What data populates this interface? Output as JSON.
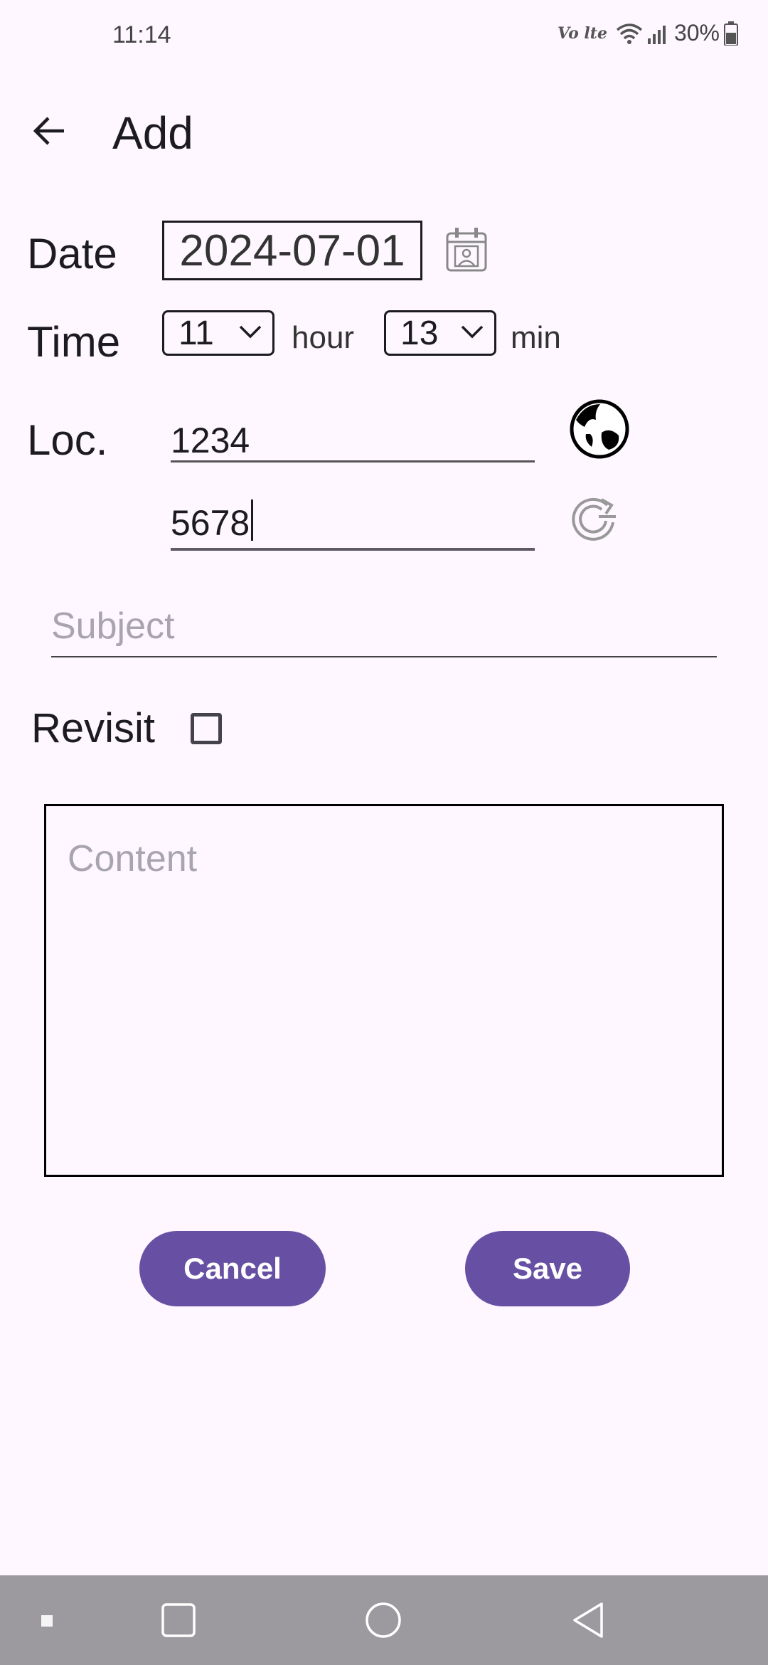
{
  "status_bar": {
    "time": "11:14",
    "network_label": "Vo lte",
    "battery": "30%"
  },
  "header": {
    "title": "Add"
  },
  "form": {
    "date_label": "Date",
    "date_value": "2024-07-01",
    "time_label": "Time",
    "hour_value": "11",
    "hour_unit": "hour",
    "min_value": "13",
    "min_unit": "min",
    "loc_label": "Loc.",
    "loc_value_1": "1234",
    "loc_value_2": "5678",
    "subject_placeholder": "Subject",
    "revisit_label": "Revisit",
    "revisit_checked": false,
    "content_placeholder": "Content"
  },
  "actions": {
    "cancel_label": "Cancel",
    "save_label": "Save"
  },
  "colors": {
    "background": "#FEF7FF",
    "primary": "#6750A4",
    "navbar": "#9C9A9E"
  },
  "icons": [
    "back-arrow-icon",
    "calendar-icon",
    "globe-location-icon",
    "refresh-icon",
    "wifi-icon",
    "signal-icon",
    "battery-icon",
    "recents-icon",
    "home-icon",
    "back-nav-icon"
  ]
}
